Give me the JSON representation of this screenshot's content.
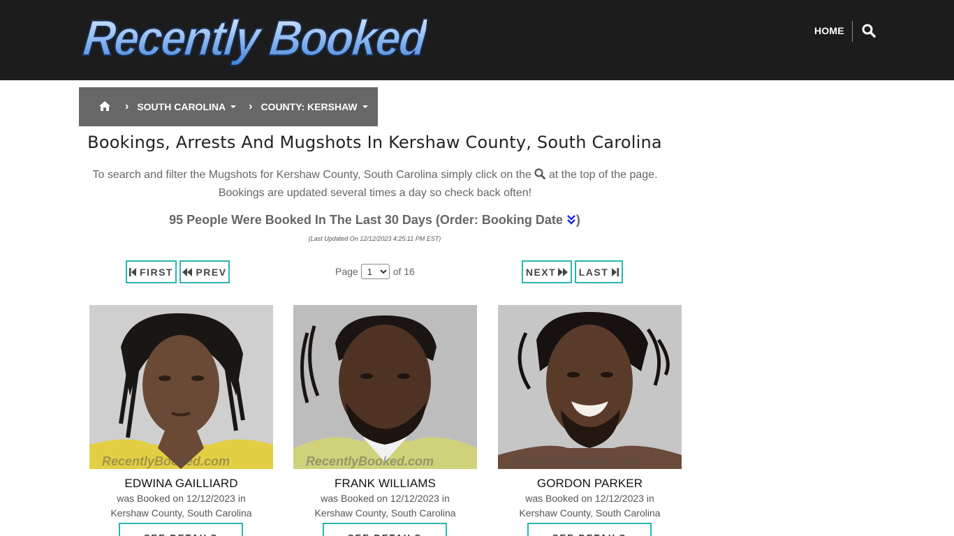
{
  "header": {
    "logo_text": "Recently Booked",
    "nav_home": "HOME",
    "search_icon": "search-icon"
  },
  "breadcrumb": {
    "home_icon": "home-icon",
    "state": "SOUTH CAROLINA",
    "county": "COUNTY: KERSHAW"
  },
  "main": {
    "title": "Bookings, Arrests And Mugshots In Kershaw County, South Carolina",
    "intro_before": "To search and filter the Mugshots for Kershaw County, South Carolina simply click on the",
    "intro_after": "at the top of the page. Bookings are updated several times a day so check back often!",
    "count_text": "95 People Were Booked In The Last 30 Days (Order: Booking Date",
    "count_close": ")",
    "last_updated": "(Last Updated On 12/12/2023 4:25:11 PM EST)"
  },
  "pagination": {
    "first": "FIRST",
    "prev": "PREV",
    "next": "NEXT",
    "last": "LAST",
    "page_label": "Page",
    "current_page": "1",
    "of_label": "of 16"
  },
  "cards": [
    {
      "name": "EDWINA GAILLIARD",
      "booked_line": "was Booked on 12/12/2023 in",
      "location": "Kershaw County, South Carolina",
      "details": "SEE DETAILS",
      "watermark": "RecentlyBooked.com"
    },
    {
      "name": "FRANK WILLIAMS",
      "booked_line": "was Booked on 12/12/2023 in",
      "location": "Kershaw County, South Carolina",
      "details": "SEE DETAILS",
      "watermark": "RecentlyBooked.com"
    },
    {
      "name": "GORDON PARKER",
      "booked_line": "was Booked on 12/12/2023 in",
      "location": "Kershaw County, South Carolina",
      "details": "SEE DETAILS",
      "watermark": "RecentlyBooked.com"
    }
  ],
  "colors": {
    "header_bg": "#1c1c1c",
    "breadcrumb_bg": "#676767",
    "button_border": "#2bb5ad",
    "order_icon": "#1a2bd6"
  }
}
